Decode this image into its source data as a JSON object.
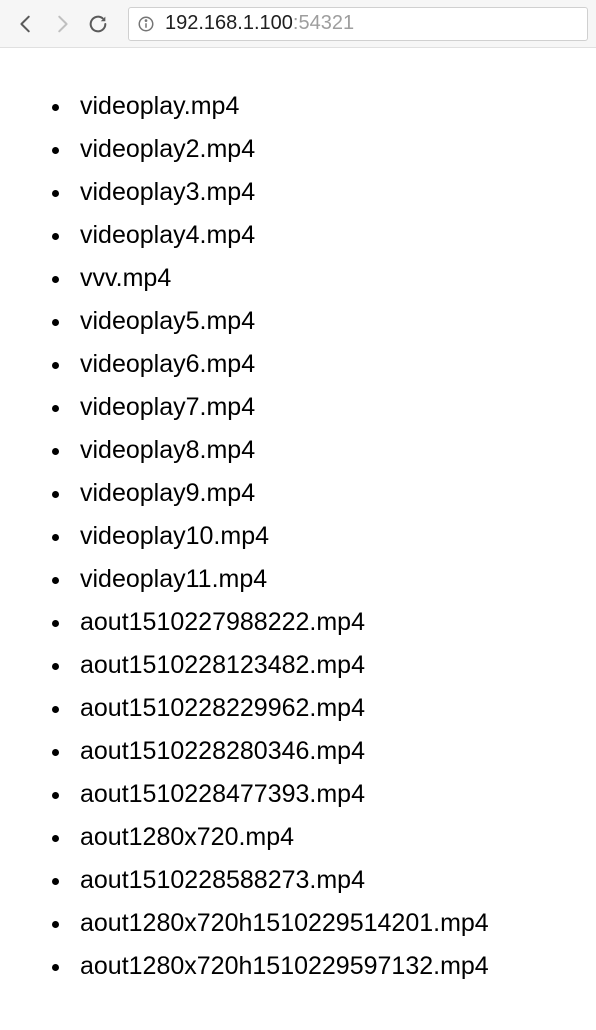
{
  "address": {
    "host": "192.168.1.100",
    "port": ":54321"
  },
  "files": [
    "videoplay.mp4",
    "videoplay2.mp4",
    "videoplay3.mp4",
    "videoplay4.mp4",
    "vvv.mp4",
    "videoplay5.mp4",
    "videoplay6.mp4",
    "videoplay7.mp4",
    "videoplay8.mp4",
    "videoplay9.mp4",
    "videoplay10.mp4",
    "videoplay11.mp4",
    "aout1510227988222.mp4",
    "aout1510228123482.mp4",
    "aout1510228229962.mp4",
    "aout1510228280346.mp4",
    "aout1510228477393.mp4",
    "aout1280x720.mp4",
    "aout1510228588273.mp4",
    "aout1280x720h1510229514201.mp4",
    "aout1280x720h1510229597132.mp4"
  ]
}
